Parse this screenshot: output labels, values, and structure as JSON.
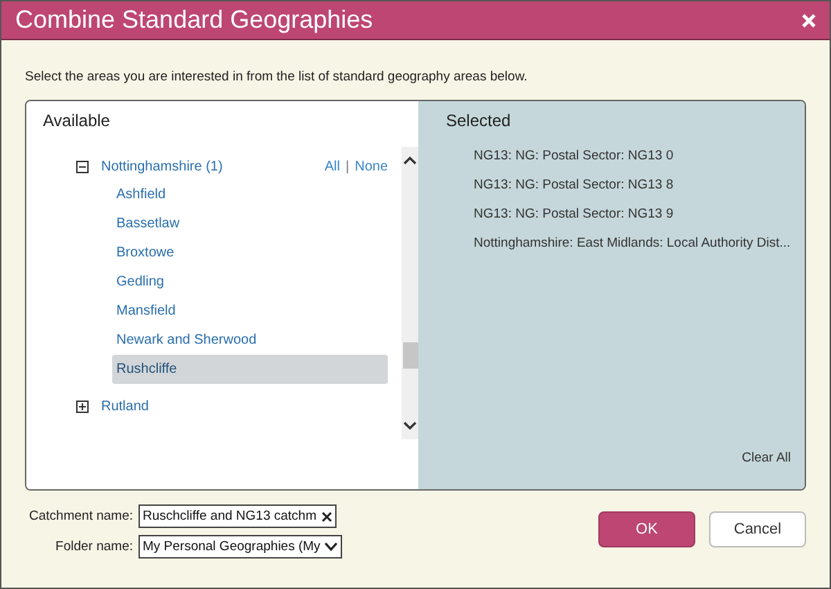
{
  "window": {
    "title": "Combine Standard Geographies"
  },
  "instruction": "Select the areas you are interested in from the list of standard geography areas below.",
  "available": {
    "heading": "Available",
    "links": [
      "All",
      "None"
    ],
    "link_separator": "|",
    "tree": [
      {
        "label": "Nottinghamshire (1)",
        "expanded": true,
        "children": [
          {
            "label": "Ashfield",
            "selected": false
          },
          {
            "label": "Bassetlaw",
            "selected": false
          },
          {
            "label": "Broxtowe",
            "selected": false
          },
          {
            "label": "Gedling",
            "selected": false
          },
          {
            "label": "Mansfield",
            "selected": false
          },
          {
            "label": "Newark and Sherwood",
            "selected": false
          },
          {
            "label": "Rushcliffe",
            "selected": true
          }
        ]
      },
      {
        "label": "Rutland",
        "expanded": false
      }
    ]
  },
  "selected": {
    "heading": "Selected",
    "items": [
      "NG13: NG: Postal Sector: NG13 0",
      "NG13: NG: Postal Sector: NG13 8",
      "NG13: NG: Postal Sector: NG13 9",
      "Nottinghamshire: East Midlands: Local Authority Dist..."
    ],
    "clear": "Clear All"
  },
  "form": {
    "catchment_label": "Catchment name:",
    "catchment_value": "Ruschcliffe and NG13 catchm",
    "folder_label": "Folder name:",
    "folder_value": "My Personal Geographies (My"
  },
  "buttons": {
    "ok": "OK",
    "cancel": "Cancel"
  }
}
